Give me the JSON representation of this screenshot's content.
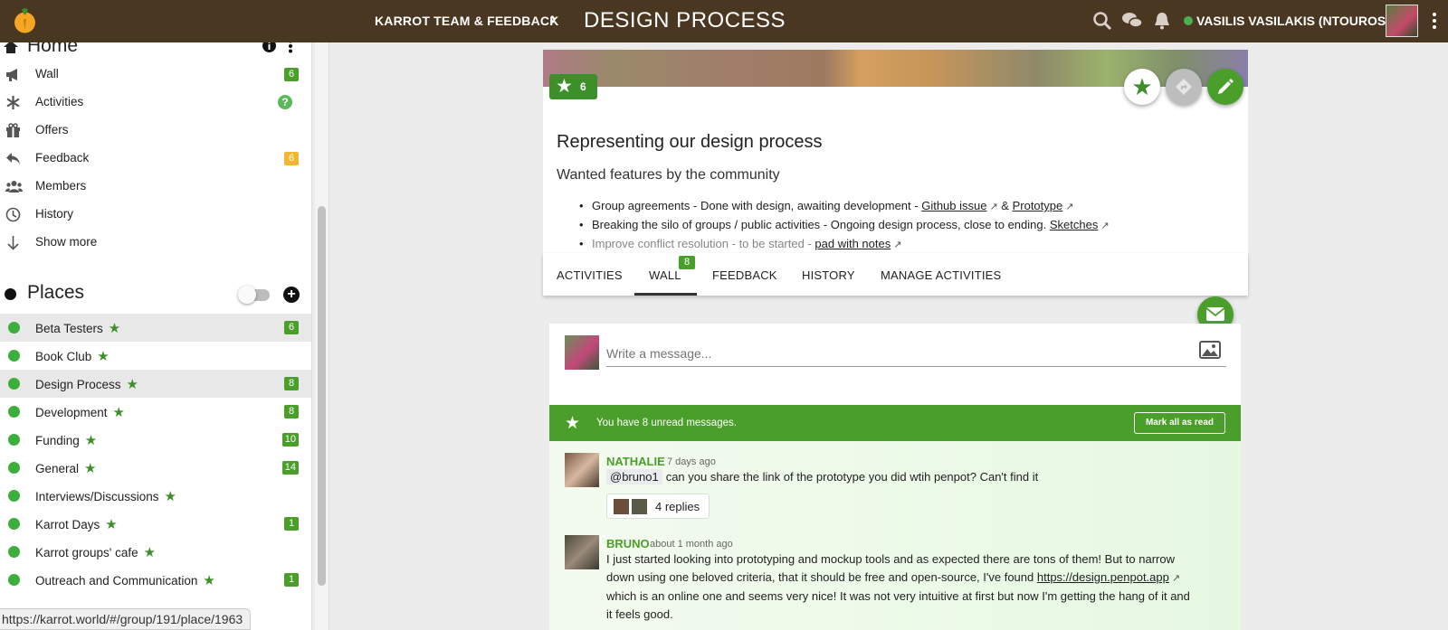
{
  "topbar": {
    "group": "KARROT TEAM & FEEDBACK",
    "chevron": "›",
    "place": "DESIGN PROCESS",
    "user": "VASILIS VASILAKIS (NTOUROS)"
  },
  "sidebar": {
    "home_label": "Home",
    "items": [
      {
        "label": "Wall",
        "badge": "6",
        "icon": "megaphone-icon"
      },
      {
        "label": "Activities",
        "badge": "?",
        "icon": "asterisk-icon"
      },
      {
        "label": "Offers",
        "badge": "",
        "icon": "gift-icon"
      },
      {
        "label": "Feedback",
        "badge": "6",
        "icon": "reply-icon"
      },
      {
        "label": "Members",
        "badge": "",
        "icon": "users-icon"
      },
      {
        "label": "History",
        "badge": "",
        "icon": "clock-icon"
      },
      {
        "label": "Show more",
        "badge": "",
        "icon": "arrow-down-icon"
      }
    ],
    "places_label": "Places",
    "places": [
      {
        "label": "Beta Testers",
        "badge": "6"
      },
      {
        "label": "Book Club",
        "badge": ""
      },
      {
        "label": "Design Process",
        "badge": "8"
      },
      {
        "label": "Development",
        "badge": "8"
      },
      {
        "label": "Funding",
        "badge": "10"
      },
      {
        "label": "General",
        "badge": "14"
      },
      {
        "label": "Interviews/Discussions",
        "badge": ""
      },
      {
        "label": "Karrot Days",
        "badge": "1"
      },
      {
        "label": "Karrot groups' cafe",
        "badge": ""
      },
      {
        "label": "Outreach and Communication",
        "badge": "1"
      }
    ],
    "status_url": "https://karrot.world/#/group/191/place/1963"
  },
  "place_card": {
    "star_count": "6",
    "title": "Representing our design process",
    "subtitle": "Wanted features by the community",
    "bullets": [
      {
        "text": "Group agreements - Done with design, awaiting development - ",
        "link1": "Github issue",
        "sep": " & ",
        "link2": "Prototype"
      },
      {
        "text": "Breaking the silo of groups / public activities - Ongoing design process, close to ending. ",
        "link1": "Sketches"
      },
      {
        "text": "Improve conflict resolution - to be started - ",
        "link1": "pad with notes"
      }
    ]
  },
  "tabs": {
    "activities": "ACTIVITIES",
    "wall": "WALL",
    "wall_badge": "8",
    "feedback": "FEEDBACK",
    "history": "HISTORY",
    "manage": "MANAGE ACTIVITIES"
  },
  "compose": {
    "placeholder": "Write a message..."
  },
  "unread": {
    "text": "You have 8 unread messages.",
    "button": "Mark all as read"
  },
  "messages": [
    {
      "author": "NATHALIE",
      "time": "7 days ago",
      "mention": "@bruno1",
      "text": "can you share the link of the prototype you did wtih penpot? Can't find it",
      "replies": "4 replies"
    },
    {
      "author": "BRUNO",
      "time": "about 1 month ago",
      "text1": "I just started looking into prototyping and mockup tools and as expected there are tons of them! But to narrow",
      "text2": "down using one beloved criteria, that it should be free and open-source, I've found ",
      "link": "https://design.penpot.app",
      "text3": "which is an online one and seems very nice! It was not very intuitive at first but now I'm getting the hang of it and",
      "text4": "it feels good."
    }
  ],
  "colors": {
    "topbar": "#4a3721",
    "accent_green": "#4a9e2a",
    "badge_orange": "#f2b632"
  }
}
